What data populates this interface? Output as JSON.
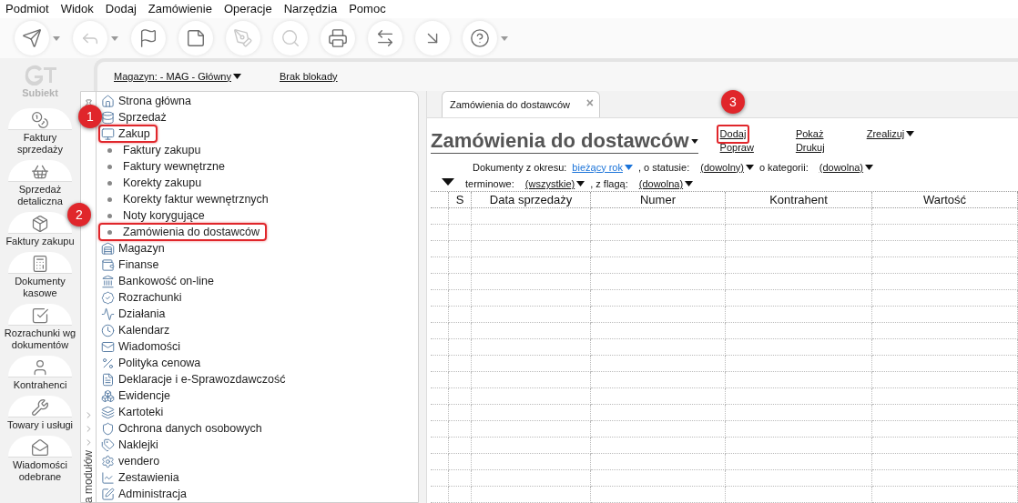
{
  "menu": [
    "Podmiot",
    "Widok",
    "Dodaj",
    "Zamówienie",
    "Operacje",
    "Narzędzia",
    "Pomoc"
  ],
  "toolbar": [
    {
      "disabled": false,
      "caret": true
    },
    {
      "disabled": true,
      "caret": true
    },
    {
      "disabled": false,
      "caret": false
    },
    {
      "disabled": false,
      "caret": false
    },
    {
      "disabled": true,
      "caret": false
    },
    {
      "disabled": true,
      "caret": false
    },
    {
      "disabled": false,
      "caret": false
    },
    {
      "disabled": false,
      "caret": false
    },
    {
      "disabled": false,
      "caret": false
    },
    {
      "disabled": false,
      "caret": true
    }
  ],
  "logo": "Subiekt",
  "modules": [
    "Faktury\nsprzedaży",
    "Sprzedaż\ndetaliczna",
    "Faktury zakupu",
    "Dokumenty\nkasowe",
    "Rozrachunki wg\ndokumentów",
    "Kontrahenci",
    "Towary i usługi",
    "Wiadomości\nodebrane"
  ],
  "topbar": {
    "warehouse": "Magazyn: - MAG - Główny",
    "lock": "Brak blokady"
  },
  "tree": [
    {
      "label": "Strona główna"
    },
    {
      "label": "Sprzedaż"
    },
    {
      "label": "Zakup",
      "highlighted": true,
      "marker": "1",
      "expanded": true,
      "children": [
        {
          "label": "Faktury zakupu"
        },
        {
          "label": "Faktury wewnętrzne"
        },
        {
          "label": "Korekty zakupu"
        },
        {
          "label": "Korekty faktur wewnętrznych"
        },
        {
          "label": "Noty korygujące"
        },
        {
          "label": "Zamówienia do dostawców",
          "highlighted": true,
          "marker": "2"
        }
      ]
    },
    {
      "label": "Magazyn"
    },
    {
      "label": "Finanse"
    },
    {
      "label": "Bankowość on-line"
    },
    {
      "label": "Rozrachunki"
    },
    {
      "label": "Działania"
    },
    {
      "label": "Kalendarz"
    },
    {
      "label": "Wiadomości"
    },
    {
      "label": "Polityka cenowa"
    },
    {
      "label": "Deklaracje i e-Sprawozdawczość"
    },
    {
      "label": "Ewidencje"
    },
    {
      "label": "Kartoteki"
    },
    {
      "label": "Ochrona danych osobowych"
    },
    {
      "label": "Naklejki"
    },
    {
      "label": "vendero"
    },
    {
      "label": "Zestawienia"
    },
    {
      "label": "Administracja"
    }
  ],
  "modules_list_label": "a modułów",
  "tab": {
    "label": "Zamówienia do dostawców",
    "close": "×"
  },
  "title": "Zamówienia do dostawców",
  "actions": [
    {
      "label": "Dodaj",
      "highlighted": true,
      "marker": "3",
      "dropdown": false
    },
    {
      "label": "Popraw",
      "highlighted": false,
      "dropdown": false
    },
    {
      "label": "Pokaż",
      "highlighted": false,
      "dropdown": false
    },
    {
      "label": "Drukuj",
      "highlighted": false,
      "dropdown": false
    },
    {
      "label": "Zrealizuj",
      "highlighted": false,
      "dropdown": true
    }
  ],
  "filters": [
    [
      {
        "kind": "text",
        "text": "Dokumenty z okresu:"
      },
      {
        "kind": "link",
        "text": "bieżący rok"
      },
      {
        "kind": "text",
        "text": ", o statusie:"
      },
      {
        "kind": "dropdown",
        "text": "(dowolny)"
      },
      {
        "kind": "text",
        "text": "o kategorii:"
      },
      {
        "kind": "dropdown",
        "text": "(dowolna)"
      }
    ],
    [
      {
        "kind": "text",
        "text": "terminowe:"
      },
      {
        "kind": "dropdown",
        "text": "(wszystkie)"
      },
      {
        "kind": "text",
        "text": ", z flagą:"
      },
      {
        "kind": "dropdown",
        "text": "(dowolna)"
      }
    ]
  ],
  "table": {
    "columns": [
      "",
      "S",
      "Data sprzedaży",
      "Numer",
      "Kontrahent",
      "Wartość"
    ]
  }
}
